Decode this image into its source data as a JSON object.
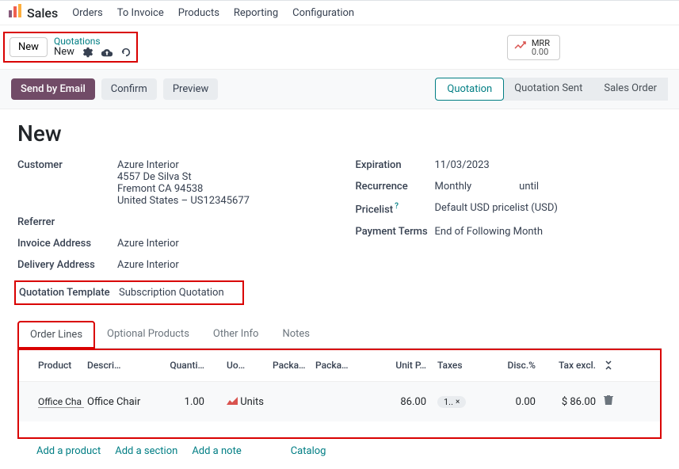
{
  "nav": {
    "app": "Sales",
    "items": [
      "Orders",
      "To Invoice",
      "Products",
      "Reporting",
      "Configuration"
    ]
  },
  "breadcrumb": {
    "section": "Quotations",
    "current": "New",
    "new_button": "New"
  },
  "mrr": {
    "label": "MRR",
    "value": "0.00"
  },
  "actions": {
    "send_email": "Send by Email",
    "confirm": "Confirm",
    "preview": "Preview"
  },
  "stages": [
    "Quotation",
    "Quotation Sent",
    "Sales Order"
  ],
  "title": "New",
  "fields": {
    "customer_label": "Customer",
    "customer_name": "Azure Interior",
    "customer_addr1": "4557 De Silva St",
    "customer_addr2": "Fremont CA 94538",
    "customer_addr3": "United States – US12345677",
    "referrer_label": "Referrer",
    "invoice_address_label": "Invoice Address",
    "invoice_address": "Azure Interior",
    "delivery_address_label": "Delivery Address",
    "delivery_address": "Azure Interior",
    "quotation_template_label": "Quotation Template",
    "quotation_template": "Subscription Quotation",
    "expiration_label": "Expiration",
    "expiration": "11/03/2023",
    "recurrence_label": "Recurrence",
    "recurrence": "Monthly",
    "recurrence_until": "until",
    "pricelist_label": "Pricelist",
    "pricelist": "Default USD pricelist (USD)",
    "payment_terms_label": "Payment Terms",
    "payment_terms": "End of Following Month"
  },
  "tabs": [
    "Order Lines",
    "Optional Products",
    "Other Info",
    "Notes"
  ],
  "columns": {
    "product": "Product",
    "description": "Descri…",
    "quantity": "Quanti…",
    "uom": "Uo…",
    "packa1": "Packa…",
    "packa2": "Packa…",
    "unit_price": "Unit P…",
    "taxes": "Taxes",
    "disc": "Disc.%",
    "tax_excl": "Tax excl."
  },
  "line": {
    "product": "Office Cha",
    "description": "Office Chair",
    "quantity": "1.00",
    "uom": "Units",
    "unit_price": "86.00",
    "tax_tag": "1..",
    "disc": "0.00",
    "tax_excl": "$ 86.00"
  },
  "addlinks": {
    "add_product": "Add a product",
    "add_section": "Add a section",
    "add_note": "Add a note",
    "catalog": "Catalog"
  }
}
